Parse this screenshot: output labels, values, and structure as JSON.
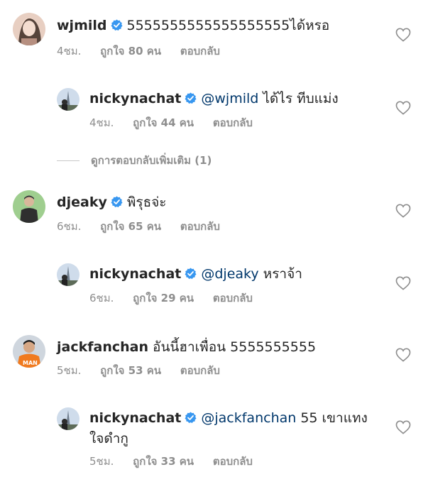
{
  "comments": [
    {
      "username": "wjmild",
      "mention": "",
      "text": "5555555555555555555ได้หรอ",
      "time": "4ชม.",
      "likes": "ถูกใจ 80 คน",
      "reply": "ตอบกลับ"
    },
    {
      "username": "nickynachat",
      "mention": "@wjmild",
      "text": " ได้ไร ทีบแม่ง",
      "time": "4ชม.",
      "likes": "ถูกใจ 44 คน",
      "reply": "ตอบกลับ"
    },
    {
      "username": "djeaky",
      "mention": "",
      "text": "พิรุธจ่ะ",
      "time": "6ชม.",
      "likes": "ถูกใจ 65 คน",
      "reply": "ตอบกลับ"
    },
    {
      "username": "nickynachat",
      "mention": "@djeaky",
      "text": " หราจ้า",
      "time": "6ชม.",
      "likes": "ถูกใจ 29 คน",
      "reply": "ตอบกลับ"
    },
    {
      "username": "jackfanchan",
      "mention": "",
      "text": "อันนี้ฮาเพื่อน 5555555555",
      "time": "5ชม.",
      "likes": "ถูกใจ 53 คน",
      "reply": "ตอบกลับ"
    },
    {
      "username": "nickynachat",
      "mention": "@jackfanchan",
      "text": " 55 เขาแทง",
      "text_line2": "ใจดำกู",
      "time": "5ชม.",
      "likes": "ถูกใจ 33 คน",
      "reply": "ตอบกลับ"
    }
  ],
  "view_more_replies": "ดูการตอบกลับเพิ่มเติม (1)",
  "colors": {
    "verified": "#3897f0",
    "mention": "#00376b",
    "meta": "#8e8e8e"
  },
  "icons": {
    "verified": "verified-badge-icon",
    "like": "heart-outline-icon"
  }
}
